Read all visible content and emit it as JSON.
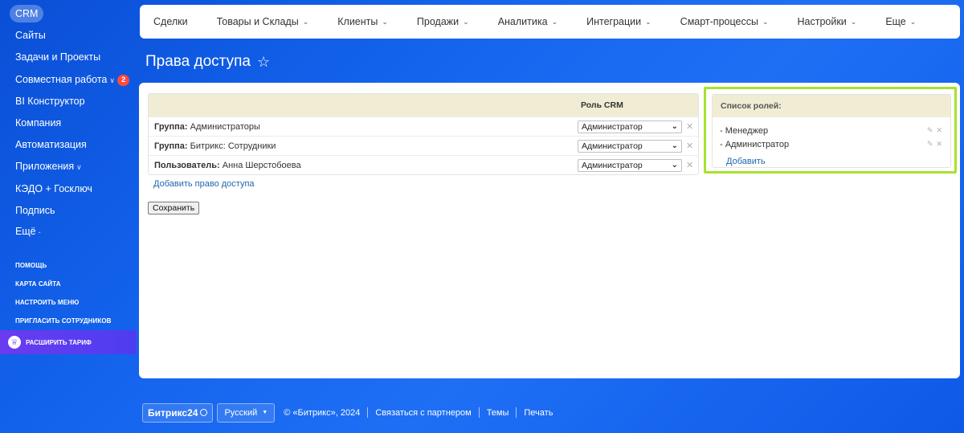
{
  "sidebar": {
    "items": [
      {
        "label": "CRM"
      },
      {
        "label": "Сайты"
      },
      {
        "label": "Задачи и Проекты"
      },
      {
        "label": "Совместная работа",
        "badge": "2"
      },
      {
        "label": "BI Конструктор"
      },
      {
        "label": "Компания"
      },
      {
        "label": "Автоматизация"
      },
      {
        "label": "Приложения"
      },
      {
        "label": "КЭДО + Госключ"
      },
      {
        "label": "Подпись"
      },
      {
        "label": "Ещё"
      }
    ],
    "links": [
      "Помощь",
      "Карта сайта",
      "Настроить меню",
      "Пригласить сотрудников"
    ],
    "upgrade_label": "Расширить тариф"
  },
  "topnav": {
    "items": [
      "Сделки",
      "Товары и Склады",
      "Клиенты",
      "Продажи",
      "Аналитика",
      "Интеграции",
      "Смарт-процессы",
      "Настройки",
      "Еще"
    ]
  },
  "page": {
    "title": "Права доступа"
  },
  "permissions": {
    "column_header": "Роль CRM",
    "rows": [
      {
        "type": "Группа:",
        "name": "Администраторы",
        "role": "Администратор"
      },
      {
        "type": "Группа:",
        "name": "Битрикс: Сотрудники",
        "role": "Администратор"
      },
      {
        "type": "Пользователь:",
        "name": "Анна Шерстобоева",
        "role": "Администратор"
      }
    ],
    "add_link": "Добавить право доступа",
    "save_label": "Сохранить"
  },
  "roles": {
    "header": "Список ролей:",
    "items": [
      "- Менеджер",
      "- Администратор"
    ],
    "add_label": "Добавить",
    "highlight_color": "#a6e22f"
  },
  "footer": {
    "logo": "Битрикс24",
    "language": "Русский",
    "copyright": "© «Битрикс», 2024",
    "links": [
      "Связаться с партнером",
      "Темы",
      "Печать"
    ]
  }
}
